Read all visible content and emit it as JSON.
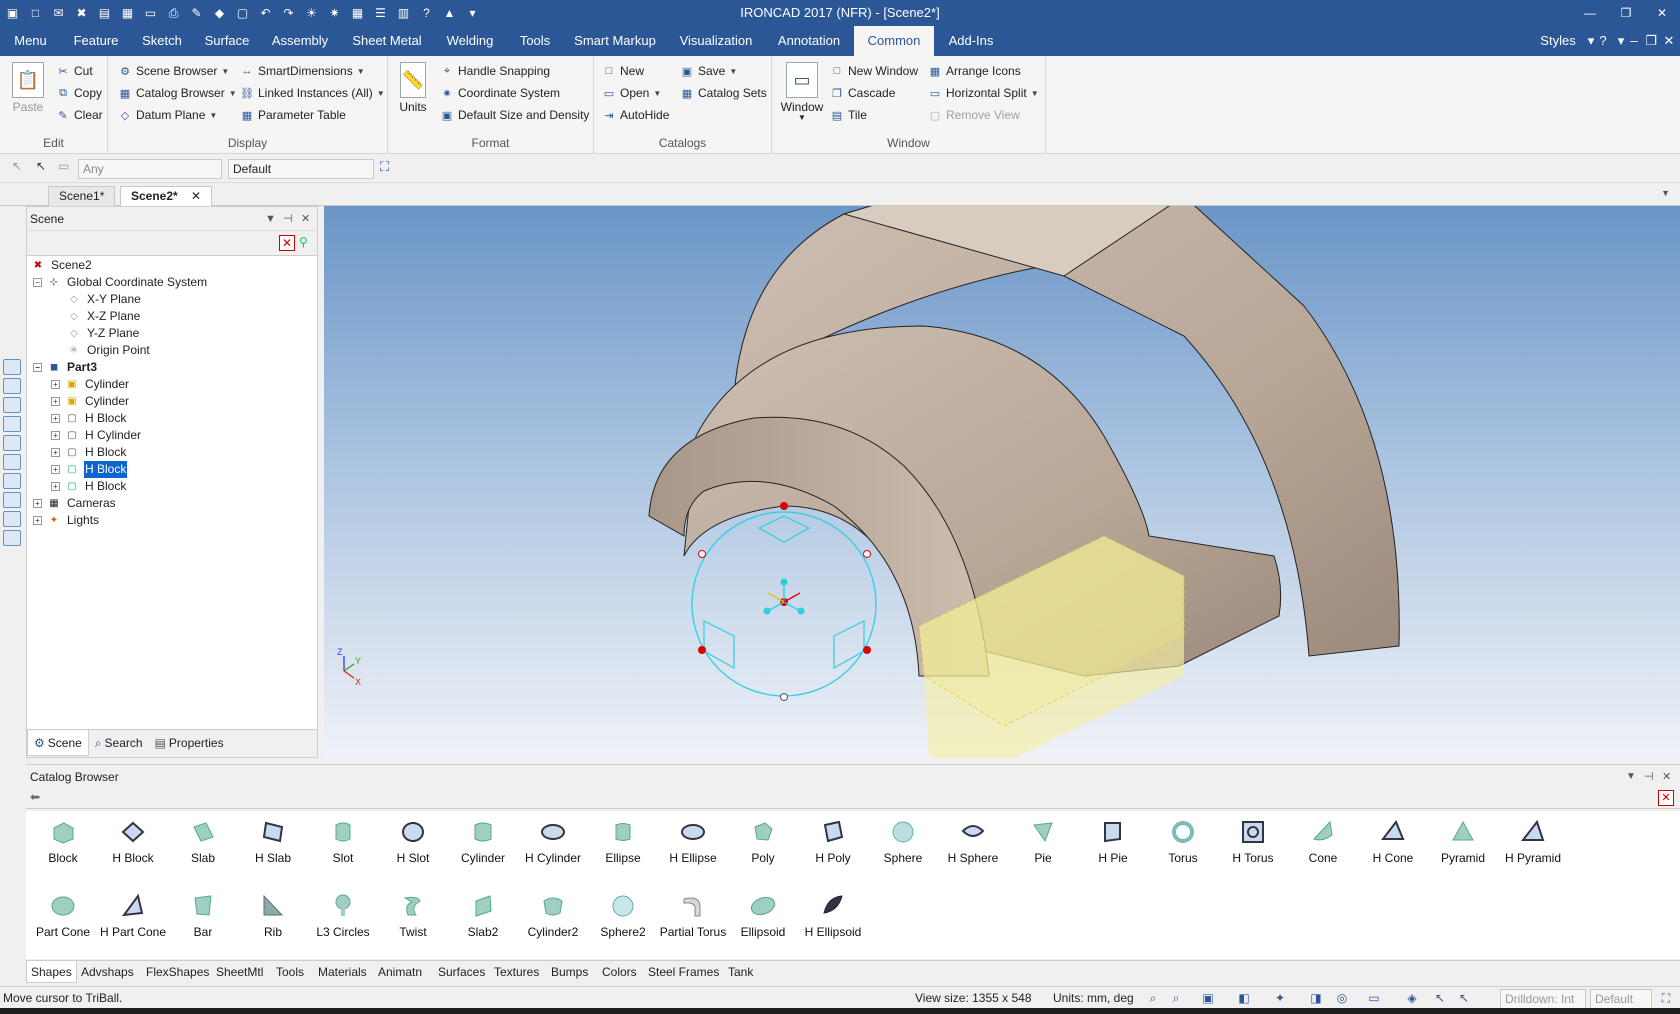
{
  "app": {
    "title": "IRONCAD 2017 (NFR) - [Scene2*]"
  },
  "menu": {
    "tabs": [
      {
        "label": "Menu"
      },
      {
        "label": "Feature"
      },
      {
        "label": "Sketch"
      },
      {
        "label": "Surface"
      },
      {
        "label": "Assembly"
      },
      {
        "label": "Sheet Metal"
      },
      {
        "label": "Welding"
      },
      {
        "label": "Tools"
      },
      {
        "label": "Smart Markup"
      },
      {
        "label": "Visualization"
      },
      {
        "label": "Annotation"
      },
      {
        "label": "Common"
      },
      {
        "label": "Add-Ins"
      }
    ],
    "active": "Common",
    "styles_label": "Styles"
  },
  "ribbon": {
    "edit": {
      "label": "Edit",
      "paste": "Paste",
      "cut": "Cut",
      "copy": "Copy",
      "clear": "Clear"
    },
    "display": {
      "label": "Display",
      "scene_browser": "Scene Browser",
      "catalog_browser": "Catalog Browser",
      "datum_plane": "Datum Plane",
      "smart_dimensions": "SmartDimensions",
      "linked_instances": "Linked Instances (All)",
      "parameter_table": "Parameter Table"
    },
    "format": {
      "label": "Format",
      "units": "Units",
      "handle_snapping": "Handle Snapping",
      "coordinate_system": "Coordinate System",
      "default_size": "Default Size and Density"
    },
    "catalogs": {
      "label": "Catalogs",
      "new": "New",
      "open": "Open",
      "autohide": "AutoHide",
      "save": "Save",
      "catalog_sets": "Catalog Sets"
    },
    "window": {
      "label": "Window",
      "window": "Window",
      "new_window": "New Window",
      "cascade": "Cascade",
      "tile": "Tile",
      "arrange_icons": "Arrange Icons",
      "horizontal_split": "Horizontal Split",
      "remove_view": "Remove View"
    }
  },
  "toolbar2": {
    "filter_value": "Any",
    "style_value": "Default"
  },
  "doc_tabs": [
    {
      "label": "Scene1*"
    },
    {
      "label": "Scene2*"
    }
  ],
  "scene_panel": {
    "title": "Scene",
    "tree": [
      {
        "label": "Scene2"
      },
      {
        "label": "Global Coordinate System"
      },
      {
        "label": "X-Y Plane"
      },
      {
        "label": "X-Z Plane"
      },
      {
        "label": "Y-Z Plane"
      },
      {
        "label": "Origin Point"
      },
      {
        "label": "Part3"
      },
      {
        "label": "Cylinder"
      },
      {
        "label": "Cylinder"
      },
      {
        "label": "H Block"
      },
      {
        "label": "H Cylinder"
      },
      {
        "label": "H Block"
      },
      {
        "label": "H Block"
      },
      {
        "label": "H Block"
      },
      {
        "label": "Cameras"
      },
      {
        "label": "Lights"
      }
    ],
    "selected": "H Block",
    "tabs": [
      {
        "label": "Scene"
      },
      {
        "label": "Search"
      },
      {
        "label": "Properties"
      }
    ]
  },
  "viewport": {
    "axis_labels": {
      "x": "X",
      "y": "Y",
      "z": "Z"
    }
  },
  "catalog": {
    "title": "Catalog Browser",
    "items": [
      {
        "label": "Block"
      },
      {
        "label": "H Block"
      },
      {
        "label": "Slab"
      },
      {
        "label": "H Slab"
      },
      {
        "label": "Slot"
      },
      {
        "label": "H Slot"
      },
      {
        "label": "Cylinder"
      },
      {
        "label": "H Cylinder"
      },
      {
        "label": "Ellipse"
      },
      {
        "label": "H Ellipse"
      },
      {
        "label": "Poly"
      },
      {
        "label": "H Poly"
      },
      {
        "label": "Sphere"
      },
      {
        "label": "H Sphere"
      },
      {
        "label": "Pie"
      },
      {
        "label": "H Pie"
      },
      {
        "label": "Torus"
      },
      {
        "label": "H Torus"
      },
      {
        "label": "Cone"
      },
      {
        "label": "H Cone"
      },
      {
        "label": "Pyramid"
      },
      {
        "label": "H Pyramid"
      },
      {
        "label": "Part Cone"
      },
      {
        "label": "H Part Cone"
      },
      {
        "label": "Bar"
      },
      {
        "label": "Rib"
      },
      {
        "label": "L3 Circles"
      },
      {
        "label": "Twist"
      },
      {
        "label": "Slab2"
      },
      {
        "label": "Cylinder2"
      },
      {
        "label": "Sphere2"
      },
      {
        "label": "Partial Torus"
      },
      {
        "label": "Ellipsoid"
      },
      {
        "label": "H Ellipsoid"
      }
    ],
    "tabs": [
      {
        "label": "Shapes"
      },
      {
        "label": "Advshaps"
      },
      {
        "label": "FlexShapes"
      },
      {
        "label": "SheetMtl"
      },
      {
        "label": "Tools"
      },
      {
        "label": "Materials"
      },
      {
        "label": "Animatn"
      },
      {
        "label": "Surfaces"
      },
      {
        "label": "Textures"
      },
      {
        "label": "Bumps"
      },
      {
        "label": "Colors"
      },
      {
        "label": "Steel Frames"
      },
      {
        "label": "Tank"
      }
    ]
  },
  "status": {
    "message": "Move cursor to TriBall.",
    "view_size": "View size: 1355 x 548",
    "units": "Units: mm, deg",
    "drilldown": "Drilldown: Int",
    "default": "Default"
  }
}
